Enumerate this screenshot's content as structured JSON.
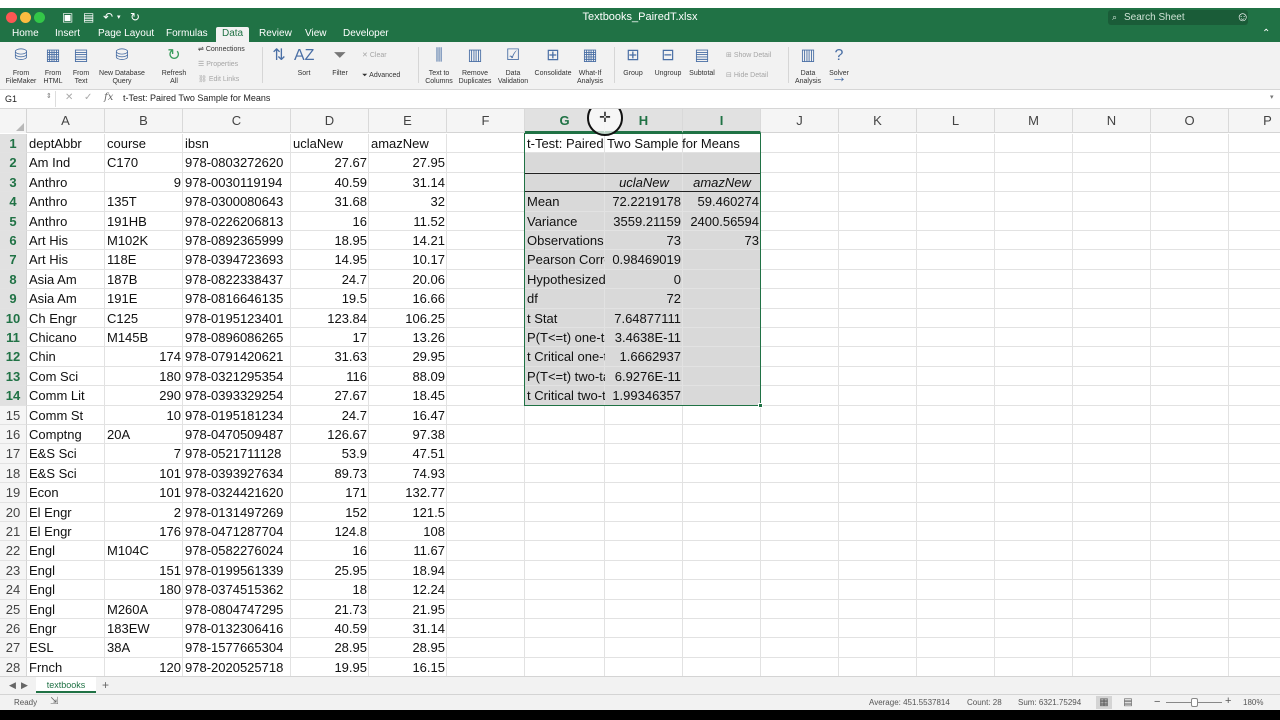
{
  "window": {
    "title": "Textbooks_PairedT.xlsx",
    "search_placeholder": "Search Sheet",
    "colors": {
      "accent": "#207245",
      "close": "#fc5753",
      "minimize": "#fdbc40",
      "zoom": "#33c748"
    }
  },
  "tabs": [
    "Home",
    "Insert",
    "Page Layout",
    "Formulas",
    "Data",
    "Review",
    "View",
    "Developer"
  ],
  "active_tab": "Data",
  "ribbon": {
    "buttons": [
      {
        "id": "from-filemaker",
        "label": "From\nFileMaker",
        "icon": "database-icon"
      },
      {
        "id": "from-html",
        "label": "From\nHTML",
        "icon": "html-file-icon"
      },
      {
        "id": "from-text",
        "label": "From\nText",
        "icon": "text-file-icon"
      },
      {
        "id": "new-database-query",
        "label": "New Database\nQuery",
        "icon": "database-query-icon"
      },
      {
        "id": "refresh-all",
        "label": "Refresh\nAll",
        "icon": "refresh-icon"
      },
      {
        "id": "sort-az",
        "label": "",
        "icon": "sort-az-icon"
      },
      {
        "id": "sort",
        "label": "Sort",
        "icon": "sort-icon"
      },
      {
        "id": "filter",
        "label": "Filter",
        "icon": "filter-icon"
      },
      {
        "id": "text-to-columns",
        "label": "Text to\nColumns",
        "icon": "text-to-columns-icon"
      },
      {
        "id": "remove-duplicates",
        "label": "Remove\nDuplicates",
        "icon": "remove-duplicates-icon"
      },
      {
        "id": "data-validation",
        "label": "Data\nValidation",
        "icon": "data-validation-icon"
      },
      {
        "id": "consolidate",
        "label": "Consolidate",
        "icon": "consolidate-icon"
      },
      {
        "id": "what-if-analysis",
        "label": "What-If\nAnalysis",
        "icon": "what-if-icon"
      },
      {
        "id": "group",
        "label": "Group",
        "icon": "group-icon"
      },
      {
        "id": "ungroup",
        "label": "Ungroup",
        "icon": "ungroup-icon"
      },
      {
        "id": "subtotal",
        "label": "Subtotal",
        "icon": "subtotal-icon"
      },
      {
        "id": "data-analysis",
        "label": "Data\nAnalysis",
        "icon": "data-analysis-icon"
      },
      {
        "id": "solver",
        "label": "Solver",
        "icon": "solver-icon"
      }
    ],
    "small": {
      "connections": "Connections",
      "properties": "Properties",
      "edit_links": "Edit Links",
      "clear": "Clear",
      "advanced": "Advanced",
      "show_detail": "Show Detail",
      "hide_detail": "Hide Detail"
    }
  },
  "formula_bar": {
    "cell_ref": "G1",
    "fx": "fx",
    "content": "t-Test: Paired Two Sample for Means"
  },
  "columns": [
    "A",
    "B",
    "C",
    "D",
    "E",
    "F",
    "G",
    "H",
    "I",
    "J",
    "K",
    "L",
    "M",
    "N",
    "O",
    "P"
  ],
  "selected_columns": [
    "G",
    "H",
    "I"
  ],
  "selected_rows": [
    1,
    2,
    3,
    4,
    5,
    6,
    7,
    8,
    9,
    10,
    11,
    12,
    13,
    14
  ],
  "row_numbers": [
    1,
    2,
    3,
    4,
    5,
    6,
    7,
    8,
    9,
    10,
    11,
    12,
    13,
    14,
    15,
    16,
    17,
    18,
    19,
    20,
    21,
    22,
    23,
    24,
    25,
    26,
    27,
    28
  ],
  "data_header": [
    "deptAbbr",
    "course",
    "ibsn",
    "uclaNew",
    "amazNew"
  ],
  "data_rows": [
    [
      "Am Ind",
      "C170",
      "978-0803272620",
      "27.67",
      "27.95"
    ],
    [
      "Anthro",
      "9",
      "978-0030119194",
      "40.59",
      "31.14"
    ],
    [
      "Anthro",
      "135T",
      "978-0300080643",
      "31.68",
      "32"
    ],
    [
      "Anthro",
      "191HB",
      "978-0226206813",
      "16",
      "11.52"
    ],
    [
      "Art His",
      "M102K",
      "978-0892365999",
      "18.95",
      "14.21"
    ],
    [
      "Art His",
      "118E",
      "978-0394723693",
      "14.95",
      "10.17"
    ],
    [
      "Asia Am",
      "187B",
      "978-0822338437",
      "24.7",
      "20.06"
    ],
    [
      "Asia Am",
      "191E",
      "978-0816646135",
      "19.5",
      "16.66"
    ],
    [
      "Ch Engr",
      "C125",
      "978-0195123401",
      "123.84",
      "106.25"
    ],
    [
      "Chicano",
      "M145B",
      "978-0896086265",
      "17",
      "13.26"
    ],
    [
      "Chin",
      "174",
      "978-0791420621",
      "31.63",
      "29.95"
    ],
    [
      "Com Sci",
      "180",
      "978-0321295354",
      "116",
      "88.09"
    ],
    [
      "Comm Lit",
      "290",
      "978-0393329254",
      "27.67",
      "18.45"
    ],
    [
      "Comm St",
      "10",
      "978-0195181234",
      "24.7",
      "16.47"
    ],
    [
      "Comptng",
      "20A",
      "978-0470509487",
      "126.67",
      "97.38"
    ],
    [
      "E&S Sci",
      "7",
      "978-0521711128",
      "53.9",
      "47.51"
    ],
    [
      "E&S Sci",
      "101",
      "978-0393927634",
      "89.73",
      "74.93"
    ],
    [
      "Econ",
      "101",
      "978-0324421620",
      "171",
      "132.77"
    ],
    [
      "El Engr",
      "2",
      "978-0131497269",
      "152",
      "121.5"
    ],
    [
      "El Engr",
      "176",
      "978-0471287704",
      "124.8",
      "108"
    ],
    [
      "Engl",
      "M104C",
      "978-0582276024",
      "16",
      "11.67"
    ],
    [
      "Engl",
      "151",
      "978-0199561339",
      "25.95",
      "18.94"
    ],
    [
      "Engl",
      "180",
      "978-0374515362",
      "18",
      "12.24"
    ],
    [
      "Engl",
      "M260A",
      "978-0804747295",
      "21.73",
      "21.95"
    ],
    [
      "Engr",
      "183EW",
      "978-0132306416",
      "40.59",
      "31.14"
    ],
    [
      "ESL",
      "38A",
      "978-1577665304",
      "28.95",
      "28.95"
    ],
    [
      "Frnch",
      "120",
      "978-2020525718",
      "19.95",
      "16.15"
    ]
  ],
  "ttest": {
    "title": "t-Test: Paired Two Sample for Means",
    "col_headers": [
      "uclaNew",
      "amazNew"
    ],
    "rows": [
      [
        "Mean",
        "72.2219178",
        "59.460274"
      ],
      [
        "Variance",
        "3559.21159",
        "2400.56594"
      ],
      [
        "Observations",
        "73",
        "73"
      ],
      [
        "Pearson Correlation",
        "0.98469019",
        ""
      ],
      [
        "Hypothesized Mean Difference",
        "0",
        ""
      ],
      [
        "df",
        "72",
        ""
      ],
      [
        "t Stat",
        "7.64877111",
        ""
      ],
      [
        "P(T<=t) one-tail",
        "3.4638E-11",
        ""
      ],
      [
        "t Critical one-tail",
        "1.6662937",
        ""
      ],
      [
        "P(T<=t) two-tail",
        "6.9276E-11",
        ""
      ],
      [
        "t Critical two-tail",
        "1.99346357",
        ""
      ]
    ]
  },
  "sheet_tab": "textbooks",
  "status": {
    "ready": "Ready",
    "average": "Average: 451.5537814",
    "count": "Count: 28",
    "sum": "Sum: 6321.75294",
    "zoom": "180%"
  }
}
